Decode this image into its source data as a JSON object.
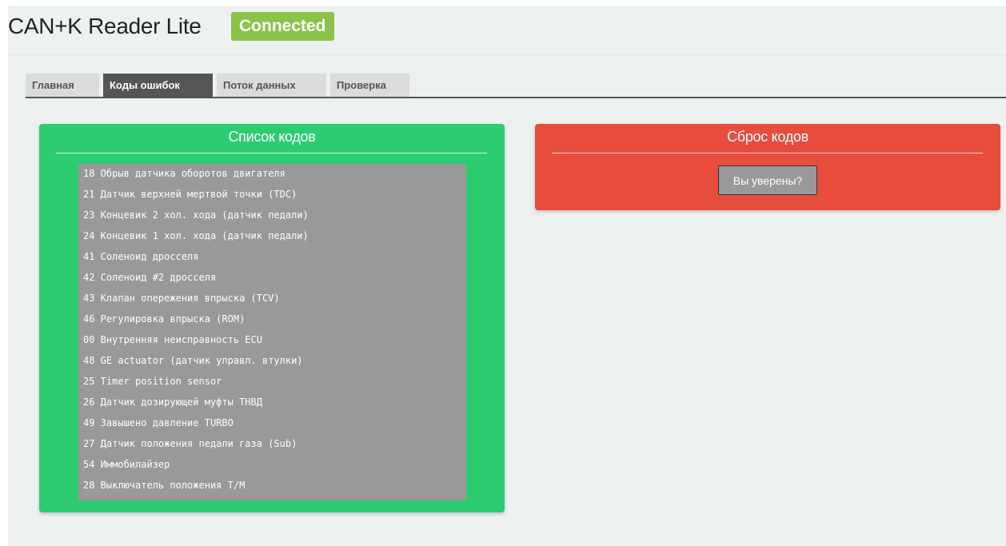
{
  "header": {
    "app_title": "CAN+K Reader Lite",
    "status_badge": "Connected"
  },
  "tabs": [
    {
      "label": "Главная",
      "active": false
    },
    {
      "label": "Коды ошибок",
      "active": true
    },
    {
      "label": "Поток данных",
      "active": false
    },
    {
      "label": "Проверка",
      "active": false
    }
  ],
  "codes_panel": {
    "title": "Список кодов",
    "items": [
      "18 Обрыв датчика оборотов двигателя",
      "21 Датчик верхней мертвой точки (TDC)",
      "23 Концевик 2 хол. хода (датчик педали)",
      "24 Концевик 1 хол. хода (датчик педали)",
      "41 Соленоид дросселя",
      "42 Соленоид #2 дросселя",
      "43 Клапан опережения впрыска (TCV)",
      "46 Регулировка впрыска (ROM)",
      "00 Внутренняя неисправность ECU",
      "48 GE actuator (датчик управл. втулки)",
      "25 Timer position sensor",
      "26 Датчик дозирующей муфты ТНВД",
      "49 Завышено давление TURBO",
      "27 Датчик положения педали газа (Sub)",
      "54 Иммобилайзер",
      "28 Выключатель положения T/M"
    ]
  },
  "reset_panel": {
    "title": "Сброс кодов",
    "confirm_button": "Вы уверены?"
  },
  "colors": {
    "codes_panel_bg": "#2ecc71",
    "reset_panel_bg": "#e74c3c",
    "status_badge_bg": "#8bc34a",
    "list_bg": "#999999",
    "active_tab_bg": "#555555"
  }
}
